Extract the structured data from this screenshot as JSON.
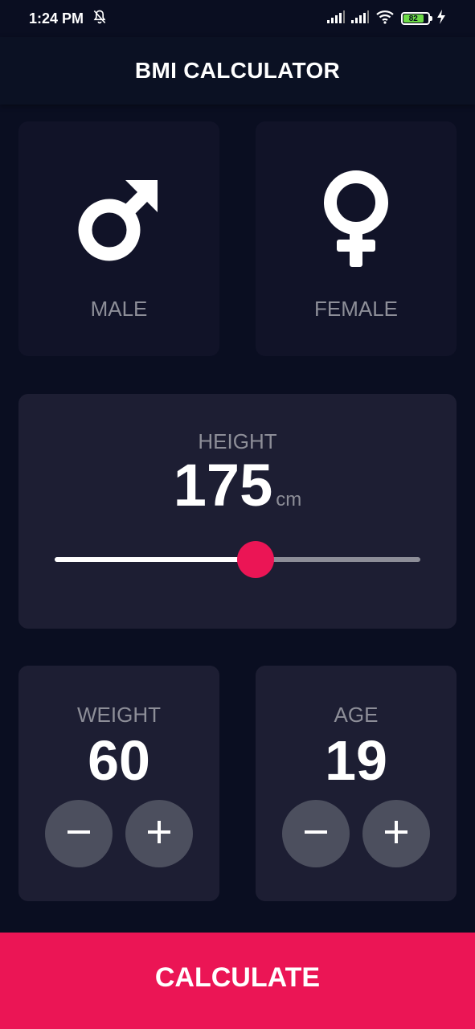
{
  "status_bar": {
    "time": "1:24 PM",
    "battery_level": "82",
    "icons": [
      "bell-off-icon",
      "signal-icon",
      "signal-icon",
      "wifi-icon",
      "battery-icon",
      "charging-icon"
    ]
  },
  "app_bar": {
    "title": "BMI CALCULATOR"
  },
  "gender": {
    "male": {
      "label": "MALE",
      "icon": "male-symbol-icon"
    },
    "female": {
      "label": "FEMALE",
      "icon": "female-symbol-icon"
    }
  },
  "height": {
    "label": "HEIGHT",
    "value": "175",
    "unit": "cm",
    "slider_fraction": 0.55
  },
  "weight": {
    "label": "WEIGHT",
    "value": "60"
  },
  "age": {
    "label": "AGE",
    "value": "19"
  },
  "calculate": {
    "label": "CALCULATE"
  },
  "colors": {
    "background": "#0a0e21",
    "card_active": "#1d1e33",
    "card_inactive": "#111328",
    "accent": "#eb1555",
    "muted_text": "#8d8e98",
    "round_button": "#4c4f5e"
  }
}
